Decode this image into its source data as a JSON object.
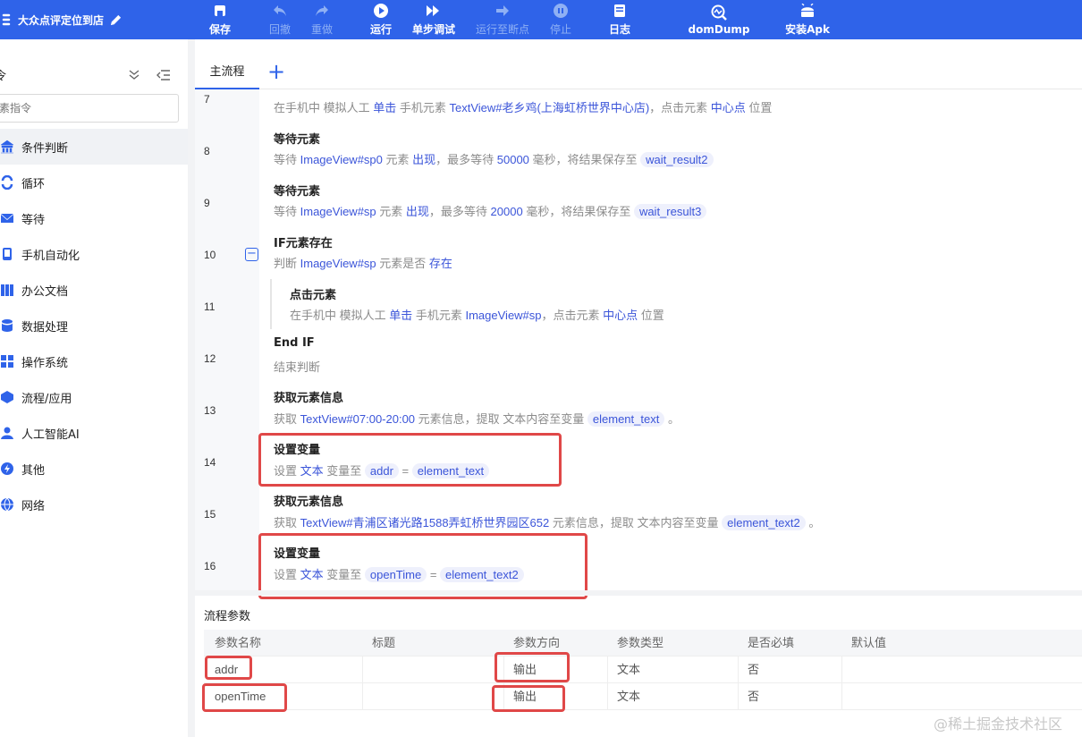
{
  "app": {
    "title": "大众点评定位到店"
  },
  "toolbar": [
    {
      "label": "保存",
      "icon": "save-icon",
      "enabled": true
    },
    {
      "label": "回撤",
      "icon": "undo-icon",
      "enabled": false
    },
    {
      "label": "重做",
      "icon": "redo-icon",
      "enabled": false
    },
    {
      "label": "运行",
      "icon": "play-icon",
      "enabled": true
    },
    {
      "label": "单步调试",
      "icon": "step-icon",
      "enabled": true
    },
    {
      "label": "运行至断点",
      "icon": "run-to-breakpoint-icon",
      "enabled": false
    },
    {
      "label": "停止",
      "icon": "stop-icon",
      "enabled": false
    },
    {
      "label": "日志",
      "icon": "log-icon",
      "enabled": true
    },
    {
      "label": "domDump",
      "icon": "dom-dump-icon",
      "enabled": true
    },
    {
      "label": "安装Apk",
      "icon": "android-icon",
      "enabled": true
    }
  ],
  "sidebar": {
    "header_label": "令",
    "search_placeholder": "素指令",
    "items": [
      {
        "label": "条件判断",
        "icon": "condition-icon"
      },
      {
        "label": "循环",
        "icon": "loop-icon"
      },
      {
        "label": "等待",
        "icon": "wait-icon"
      },
      {
        "label": "手机自动化",
        "icon": "phone-icon"
      },
      {
        "label": "办公文档",
        "icon": "document-icon"
      },
      {
        "label": "数据处理",
        "icon": "database-icon"
      },
      {
        "label": "操作系统",
        "icon": "os-icon"
      },
      {
        "label": "流程/应用",
        "icon": "flow-icon"
      },
      {
        "label": "人工智能AI",
        "icon": "ai-icon"
      },
      {
        "label": "其他",
        "icon": "other-icon"
      },
      {
        "label": "网络",
        "icon": "network-icon"
      }
    ]
  },
  "tabs": {
    "main": "主流程",
    "add": "+"
  },
  "steps": {
    "s7": {
      "no": "7",
      "d1": "在手机中 模拟人工 ",
      "h1": "单击",
      "d2": " 手机元素 ",
      "h2": "TextView#老乡鸡(上海虹桥世界中心店)",
      "d3": "，点击元素 ",
      "h3": "中心点",
      "d4": " 位置"
    },
    "s8": {
      "no": "8",
      "title": "等待元素",
      "d1": "等待 ",
      "h1": "ImageView#sp0",
      "d2": " 元素 ",
      "h2": "出现",
      "d3": "，最多等待 ",
      "h3": "50000",
      "d4": " 毫秒，将结果保存至 ",
      "p1": "wait_result2"
    },
    "s9": {
      "no": "9",
      "title": "等待元素",
      "d1": "等待 ",
      "h1": "ImageView#sp",
      "d2": " 元素 ",
      "h2": "出现",
      "d3": "，最多等待 ",
      "h3": "20000",
      "d4": " 毫秒，将结果保存至 ",
      "p1": "wait_result3"
    },
    "s10": {
      "no": "10",
      "title": "IF元素存在",
      "d1": "判断 ",
      "h1": "ImageView#sp",
      "d2": " 元素是否 ",
      "h2": "存在"
    },
    "s11": {
      "no": "11",
      "title": "点击元素",
      "d1": "在手机中 模拟人工 ",
      "h1": "单击",
      "d2": " 手机元素 ",
      "h2": "ImageView#sp",
      "d3": "，点击元素 ",
      "h3": "中心点",
      "d4": " 位置"
    },
    "s12": {
      "no": "12",
      "title": "End IF",
      "d1": "结束判断"
    },
    "s13": {
      "no": "13",
      "title": "获取元素信息",
      "d1": "获取 ",
      "h1": "TextView#07:00-20:00",
      "d2": " 元素信息，提取 文本内容至变量 ",
      "p1": "element_text",
      "d3": " 。"
    },
    "s14": {
      "no": "14",
      "title": "设置变量",
      "d1": "设置 ",
      "h1": "文本",
      "d2": " 变量至 ",
      "p1": "addr",
      "d3": " = ",
      "p2": "element_text"
    },
    "s15": {
      "no": "15",
      "title": "获取元素信息",
      "d1": "获取 ",
      "h1": "TextView#青浦区诸光路1588弄虹桥世界园区652",
      "d2": " 元素信息，提取 文本内容至变量 ",
      "p1": "element_text2",
      "d3": " 。"
    },
    "s16": {
      "no": "16",
      "title": "设置变量",
      "d1": "设置 ",
      "h1": "文本",
      "d2": " 变量至 ",
      "p1": "openTime",
      "d3": " = ",
      "p2": "element_text2"
    }
  },
  "params": {
    "title": "流程参数",
    "columns": [
      "参数名称",
      "标题",
      "参数方向",
      "参数类型",
      "是否必填",
      "默认值"
    ],
    "rows": [
      [
        "addr",
        "",
        "输出",
        "文本",
        "否",
        ""
      ],
      [
        "openTime",
        "",
        "输出",
        "文本",
        "否",
        ""
      ]
    ]
  },
  "watermark": "@稀土掘金技术社区",
  "colors": {
    "topbar": "#2f63e9",
    "highlight": "#3b55d9",
    "annotation_red": "#e04848"
  }
}
